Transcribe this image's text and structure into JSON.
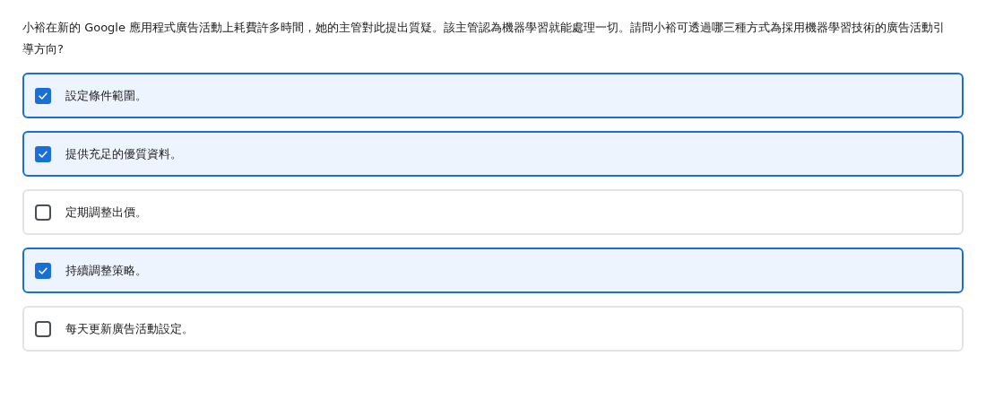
{
  "question": "小裕在新的 Google 應用程式廣告活動上耗費許多時間，她的主管對此提出質疑。該主管認為機器學習就能處理一切。請問小裕可透過哪三種方式為採用機器學習技術的廣告活動引導方向?",
  "options": [
    {
      "label": "設定條件範圍。",
      "checked": true
    },
    {
      "label": "提供充足的優質資料。",
      "checked": true
    },
    {
      "label": "定期調整出價。",
      "checked": false
    },
    {
      "label": "持續調整策略。",
      "checked": true
    },
    {
      "label": "每天更新廣告活動設定。",
      "checked": false
    }
  ]
}
